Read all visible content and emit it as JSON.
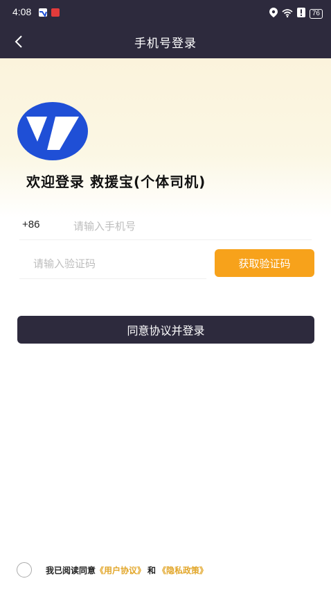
{
  "status_bar": {
    "time": "4:08",
    "battery": "76",
    "icons": [
      "location-icon",
      "wifi-icon",
      "alert-icon",
      "battery-icon"
    ]
  },
  "nav": {
    "title": "手机号登录",
    "back_icon": "chevron-left-icon"
  },
  "welcome": "欢迎登录 救援宝(个体司机)",
  "phone": {
    "country_code": "+86",
    "placeholder": "请输入手机号",
    "value": ""
  },
  "code": {
    "placeholder": "请输入验证码",
    "value": "",
    "get_code_label": "获取验证码"
  },
  "login_label": "同意协议并登录",
  "agreement": {
    "prefix": "我已阅读同意",
    "user_agreement": "《用户协议》",
    "and": "和",
    "privacy_policy": "《隐私政策》",
    "checked": false
  },
  "colors": {
    "dark_bar": "#2d2a3d",
    "accent_orange": "#f7a21b",
    "link_gold": "#e2a629",
    "logo_blue": "#1f4fd6"
  }
}
